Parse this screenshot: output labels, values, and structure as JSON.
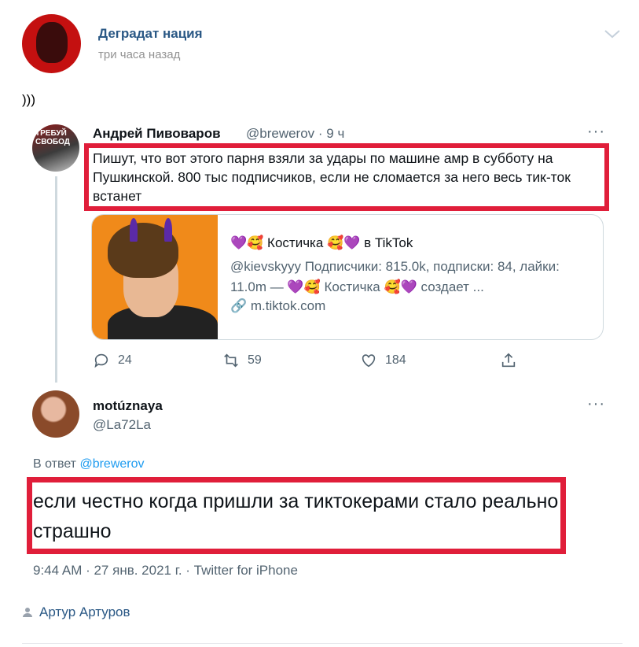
{
  "post": {
    "group_name": "Деградат нация",
    "time": "три часа назад",
    "text": ")))",
    "author": "Артур Артуров"
  },
  "tweet1": {
    "avatar_text": "ТРЕБУЙ\nСВОБОД",
    "name": "Андрей Пивоваров",
    "handle_time": "@brewerov · 9 ч",
    "more": "···",
    "text": "Пишут, что вот этого парня взяли за удары по машине амр в субботу на Пушкинской. 800 тыс подписчиков, если не сломается за него весь тик-ток встанет",
    "card": {
      "title": "💜🥰 Костичка 🥰💜 в TikTok",
      "description": "@kievskyyy Подписчики: 815.0k, подписки: 84, лайки: 11.0m — 💜🥰 Костичка 🥰💜 создает ...",
      "link": "m.tiktok.com"
    },
    "replies": "24",
    "retweets": "59",
    "likes": "184"
  },
  "tweet2": {
    "name": "motúznaya",
    "handle": "@La72La",
    "more": "···",
    "reply_prefix": "В ответ ",
    "reply_mention": "@brewerov",
    "text": "если честно когда пришли за тиктокерами стало реально страшно",
    "meta": "9:44 AM · 27 янв. 2021 г. · Twitter for iPhone"
  },
  "colors": {
    "vk_link": "#2a5885",
    "highlight": "#e01e3a",
    "twitter_gray": "#536471",
    "twitter_blue": "#1d9bf0"
  }
}
